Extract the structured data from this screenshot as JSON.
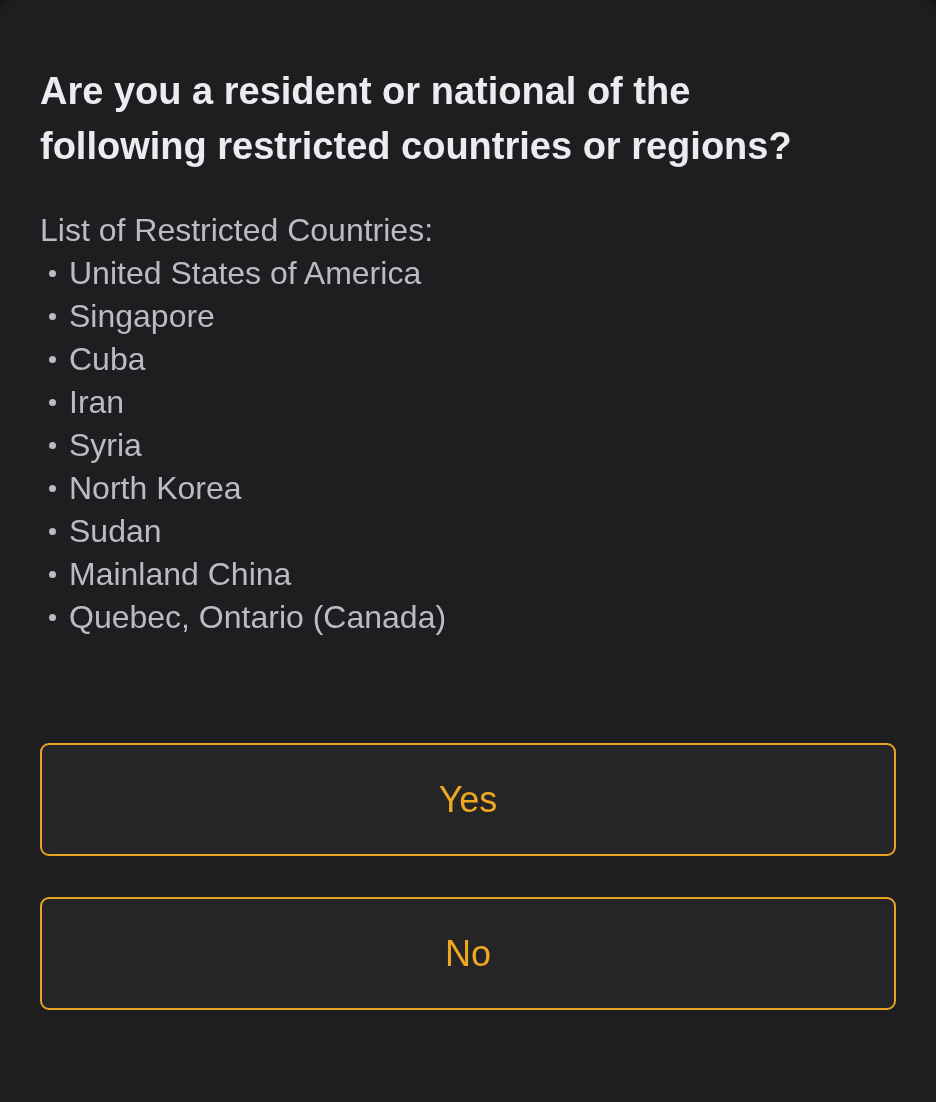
{
  "dialog": {
    "title": "Are you a resident or national of the following restricted countries or regions?",
    "list_heading": "List of Restricted Countries:",
    "countries": [
      "United States of America",
      "Singapore",
      "Cuba",
      "Iran",
      "Syria",
      "North Korea",
      "Sudan",
      "Mainland China",
      "Quebec, Ontario (Canada)"
    ],
    "buttons": [
      {
        "label": "Yes"
      },
      {
        "label": "No"
      }
    ]
  }
}
